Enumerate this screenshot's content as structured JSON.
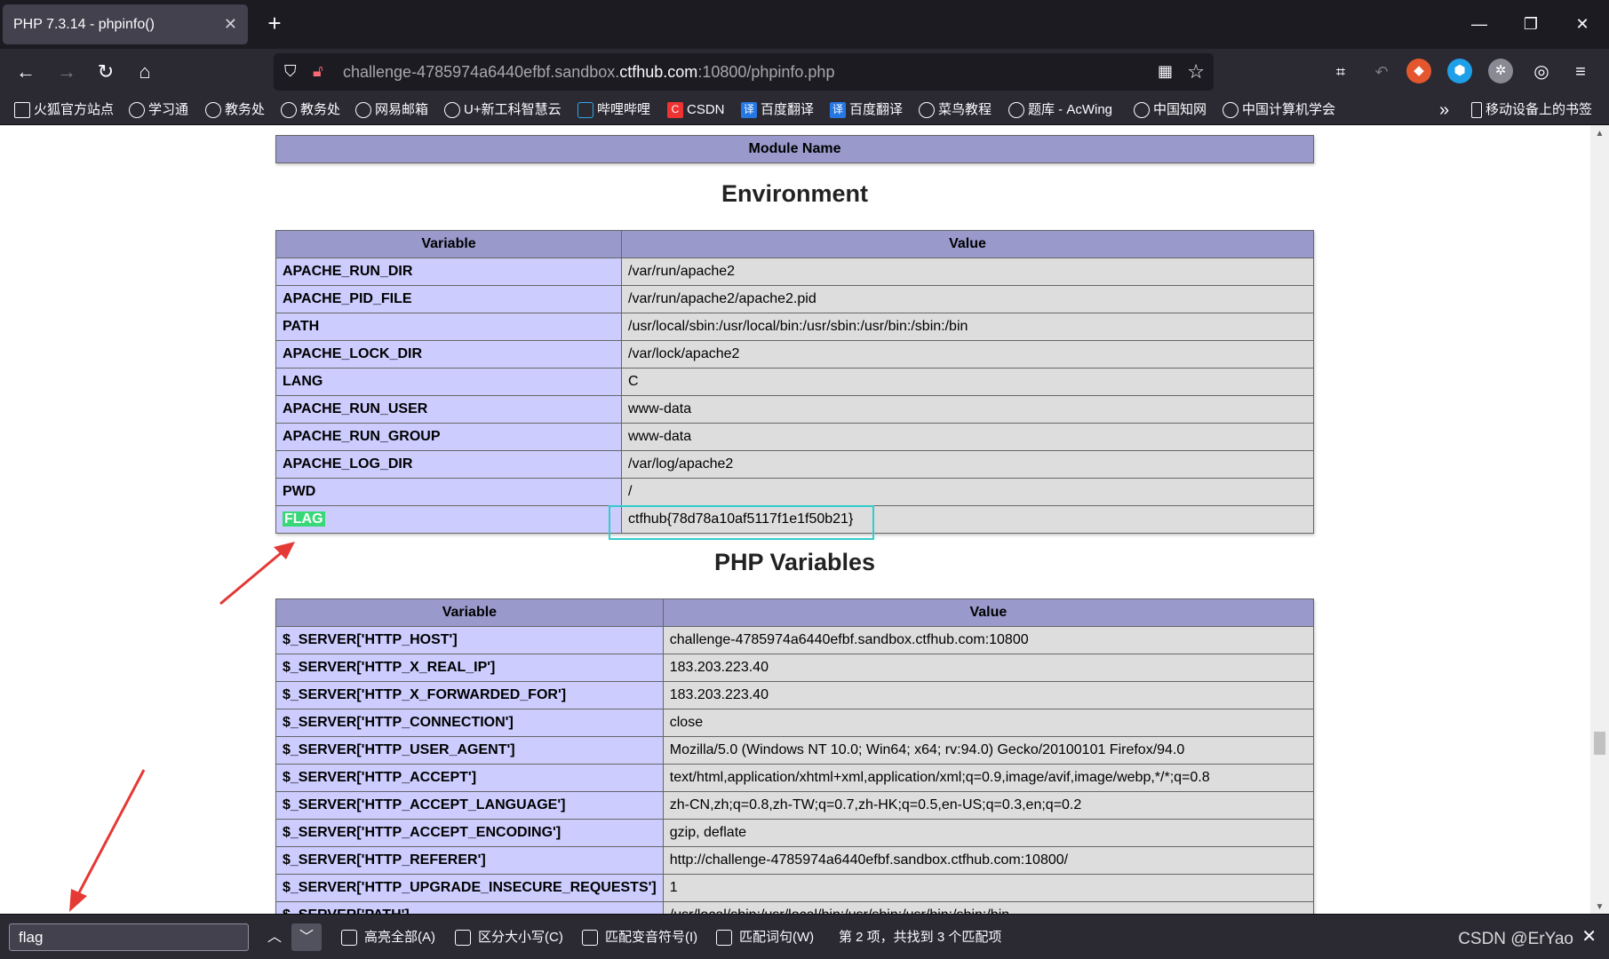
{
  "browser": {
    "tab_title": "PHP 7.3.14 - phpinfo()",
    "url_prefix": "challenge-4785974a6440efbf.sandbox.",
    "url_host": "ctfhub.com",
    "url_suffix": ":10800/phpinfo.php",
    "bookmarks": [
      {
        "label": "火狐官方站点",
        "icon": "folder-icon"
      },
      {
        "label": "学习通",
        "icon": "globe-icon"
      },
      {
        "label": "教务处",
        "icon": "globe-icon"
      },
      {
        "label": "教务处",
        "icon": "globe-icon"
      },
      {
        "label": "网易邮箱",
        "icon": "globe-icon"
      },
      {
        "label": "U+新工科智慧云",
        "icon": "globe-icon"
      },
      {
        "label": "哔哩哔哩",
        "icon": "bilibili-icon"
      },
      {
        "label": "CSDN",
        "icon": "csdn-icon"
      },
      {
        "label": "百度翻译",
        "icon": "translate-icon"
      },
      {
        "label": "百度翻译",
        "icon": "translate-icon"
      },
      {
        "label": "菜鸟教程",
        "icon": "globe-icon"
      },
      {
        "label": "题库 - AcWing",
        "icon": "globe-icon"
      },
      {
        "label": "中国知网",
        "icon": "globe-icon"
      },
      {
        "label": "中国计算机学会",
        "icon": "globe-icon"
      }
    ],
    "mobile_bookmarks": "移动设备上的书签",
    "overflow_glyph": "»"
  },
  "page": {
    "module_header": "Module Name",
    "environment_title": "Environment",
    "env_headers": [
      "Variable",
      "Value"
    ],
    "env_rows": [
      {
        "name": "APACHE_RUN_DIR",
        "value": "/var/run/apache2"
      },
      {
        "name": "APACHE_PID_FILE",
        "value": "/var/run/apache2/apache2.pid"
      },
      {
        "name": "PATH",
        "value": "/usr/local/sbin:/usr/local/bin:/usr/sbin:/usr/bin:/sbin:/bin"
      },
      {
        "name": "APACHE_LOCK_DIR",
        "value": "/var/lock/apache2"
      },
      {
        "name": "LANG",
        "value": "C"
      },
      {
        "name": "APACHE_RUN_USER",
        "value": "www-data"
      },
      {
        "name": "APACHE_RUN_GROUP",
        "value": "www-data"
      },
      {
        "name": "APACHE_LOG_DIR",
        "value": "/var/log/apache2"
      },
      {
        "name": "PWD",
        "value": "/"
      },
      {
        "name": "FLAG",
        "value": "ctfhub{78d78a10af5117f1e1f50b21}"
      }
    ],
    "php_vars_title": "PHP Variables",
    "php_headers": [
      "Variable",
      "Value"
    ],
    "php_rows": [
      {
        "name": "$_SERVER['HTTP_HOST']",
        "value": "challenge-4785974a6440efbf.sandbox.ctfhub.com:10800"
      },
      {
        "name": "$_SERVER['HTTP_X_REAL_IP']",
        "value": "183.203.223.40"
      },
      {
        "name": "$_SERVER['HTTP_X_FORWARDED_FOR']",
        "value": "183.203.223.40"
      },
      {
        "name": "$_SERVER['HTTP_CONNECTION']",
        "value": "close"
      },
      {
        "name": "$_SERVER['HTTP_USER_AGENT']",
        "value": "Mozilla/5.0 (Windows NT 10.0; Win64; x64; rv:94.0) Gecko/20100101 Firefox/94.0"
      },
      {
        "name": "$_SERVER['HTTP_ACCEPT']",
        "value": "text/html,application/xhtml+xml,application/xml;q=0.9,image/avif,image/webp,*/*;q=0.8"
      },
      {
        "name": "$_SERVER['HTTP_ACCEPT_LANGUAGE']",
        "value": "zh-CN,zh;q=0.8,zh-TW;q=0.7,zh-HK;q=0.5,en-US;q=0.3,en;q=0.2"
      },
      {
        "name": "$_SERVER['HTTP_ACCEPT_ENCODING']",
        "value": "gzip, deflate"
      },
      {
        "name": "$_SERVER['HTTP_REFERER']",
        "value": "http://challenge-4785974a6440efbf.sandbox.ctfhub.com:10800/"
      },
      {
        "name": "$_SERVER['HTTP_UPGRADE_INSECURE_REQUESTS']",
        "value": "1"
      },
      {
        "name": "$_SERVER['PATH']",
        "value": "/usr/local/sbin:/usr/local/bin:/usr/sbin:/usr/bin:/sbin:/bin"
      }
    ]
  },
  "findbar": {
    "query": "flag",
    "highlight_all": "高亮全部(A)",
    "match_case": "区分大小写(C)",
    "match_diacritics": "匹配变音符号(I)",
    "whole_words": "匹配词句(W)",
    "status": "第 2 项，共找到 3 个匹配项"
  },
  "watermark": "CSDN @ErYao",
  "colors": {
    "th": "#9999cc",
    "e": "#ccccff",
    "v": "#dddddd",
    "flag_highlight": "#38d878",
    "flag_box": "#33cccc",
    "annotation_arrow": "#e53935"
  }
}
